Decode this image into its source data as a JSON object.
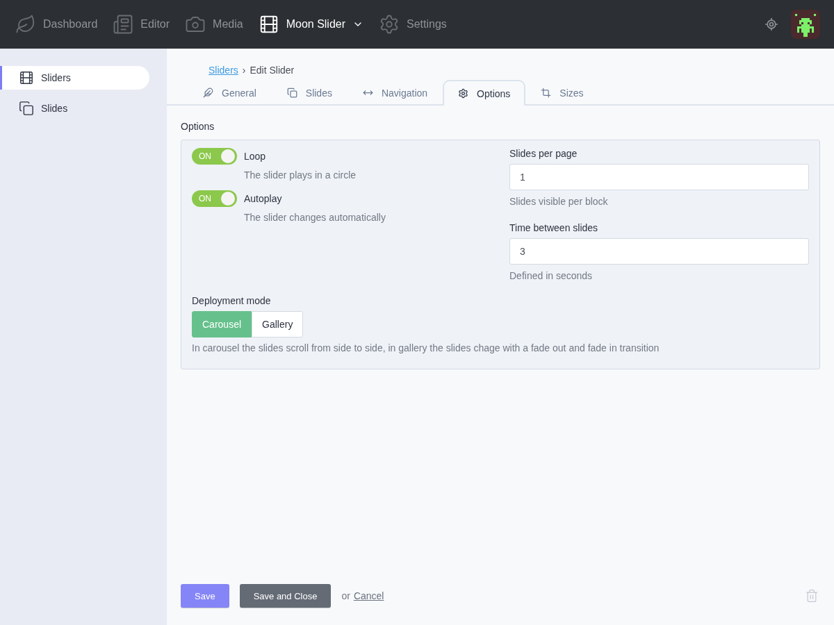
{
  "top_nav": [
    {
      "label": "Dashboard",
      "selected": false
    },
    {
      "label": "Editor",
      "selected": false
    },
    {
      "label": "Media",
      "selected": false
    },
    {
      "label": "Moon Slider",
      "selected": true,
      "dropdown": true
    },
    {
      "label": "Settings",
      "selected": false
    }
  ],
  "sidebar": {
    "items": [
      {
        "label": "Sliders",
        "selected": true
      },
      {
        "label": "Slides",
        "selected": false
      }
    ]
  },
  "breadcrumb": {
    "link": "Sliders",
    "separator": "›",
    "current": "Edit Slider"
  },
  "tabs": [
    {
      "label": "General",
      "selected": false
    },
    {
      "label": "Slides",
      "selected": false
    },
    {
      "label": "Navigation",
      "selected": false
    },
    {
      "label": "Options",
      "selected": true
    },
    {
      "label": "Sizes",
      "selected": false
    }
  ],
  "section_title": "Options",
  "toggles": [
    {
      "label": "Loop",
      "on_text": "ON",
      "on": true,
      "help": "The slider plays in a circle"
    },
    {
      "label": "Autoplay",
      "on_text": "ON",
      "on": true,
      "help": "The slider changes automatically"
    }
  ],
  "fields": [
    {
      "label": "Slides per page",
      "value": "1",
      "help": "Slides visible per block"
    },
    {
      "label": "Time between slides",
      "value": "3",
      "help": "Defined in seconds"
    }
  ],
  "deployment_mode": {
    "label": "Deployment mode",
    "options": [
      {
        "label": "Carousel",
        "selected": true
      },
      {
        "label": "Gallery",
        "selected": false
      }
    ],
    "help": "In carousel the slides scroll from side to side, in gallery the slides chage with a fade out and fade in transition"
  },
  "footer": {
    "save": "Save",
    "save_close": "Save and Close",
    "or": "or",
    "cancel": "Cancel"
  }
}
